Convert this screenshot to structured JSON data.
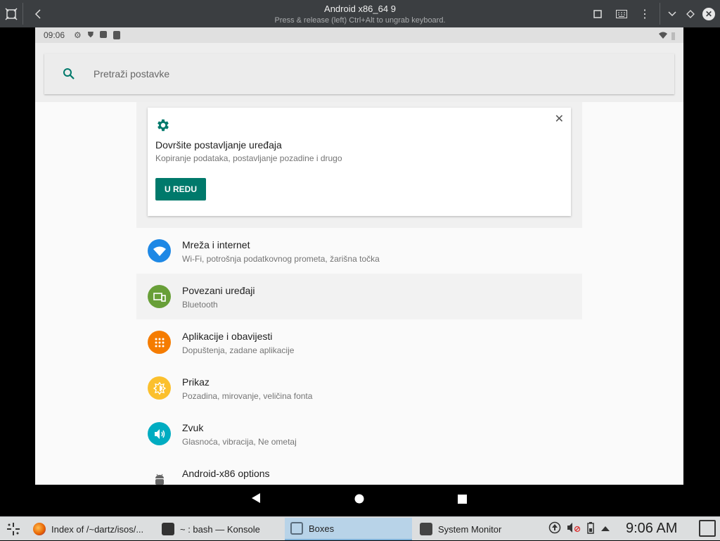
{
  "window": {
    "title": "Android x86_64 9",
    "subtitle": "Press & release (left) Ctrl+Alt to ungrab keyboard."
  },
  "android": {
    "status_time": "09:06",
    "search_placeholder": "Pretraži postavke",
    "suggestion": {
      "title": "Dovršite postavljanje uređaja",
      "subtitle": "Kopiranje podataka, postavljanje pozadine i drugo",
      "button": "U REDU"
    },
    "settings": [
      {
        "title": "Mreža i internet",
        "subtitle": "Wi-Fi, potrošnja podatkovnog prometa, žarišna točka",
        "color": "#1e88e5",
        "icon": "wifi-icon"
      },
      {
        "title": "Povezani uređaji",
        "subtitle": "Bluetooth",
        "color": "#689f38",
        "icon": "devices-icon"
      },
      {
        "title": "Aplikacije i obavijesti",
        "subtitle": "Dopuštenja, zadane aplikacije",
        "color": "#f57c00",
        "icon": "apps-icon"
      },
      {
        "title": "Prikaz",
        "subtitle": "Pozadina, mirovanje, veličina fonta",
        "color": "#fbc02d",
        "icon": "brightness-icon"
      },
      {
        "title": "Zvuk",
        "subtitle": "Glasnoća, vibracija, Ne ometaj",
        "color": "#00acc1",
        "icon": "volume-icon"
      },
      {
        "title": "Android-x86 options",
        "subtitle": "",
        "color": "#fafafa",
        "icon": "android-icon"
      }
    ],
    "accent": "#00796b"
  },
  "taskbar": {
    "tasks": [
      {
        "label": "Index of /~dartz/isos/...",
        "icon": "firefox-icon"
      },
      {
        "label": "~ : bash — Konsole",
        "icon": "konsole-icon"
      },
      {
        "label": "Boxes",
        "icon": "boxes-icon"
      },
      {
        "label": "System Monitor",
        "icon": "system-monitor-icon"
      }
    ],
    "clock": "9:06 AM"
  }
}
